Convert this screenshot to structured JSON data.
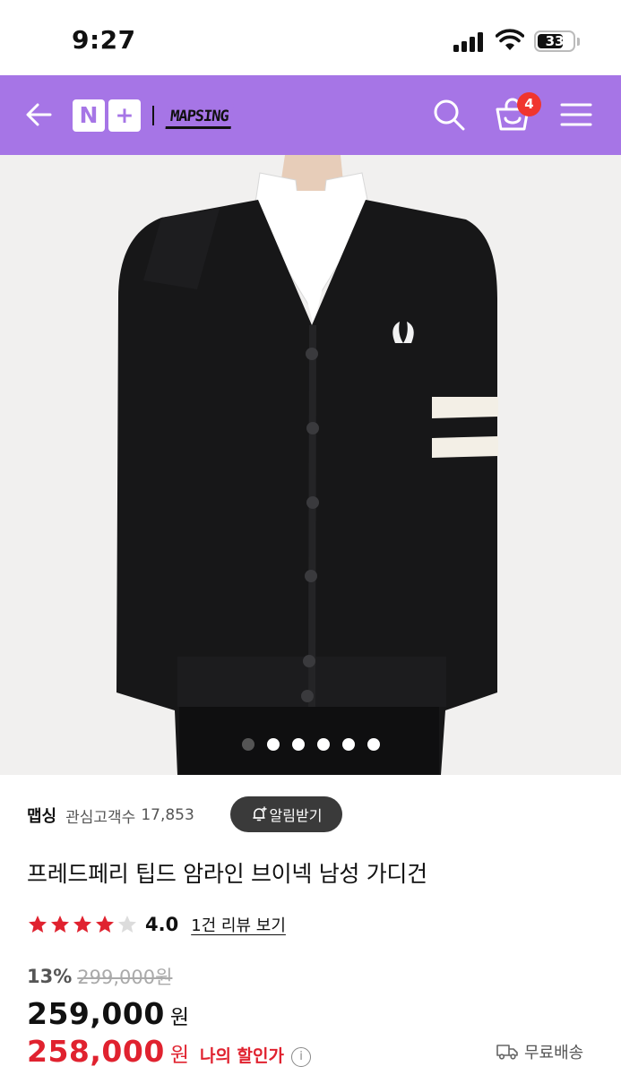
{
  "status_bar": {
    "time": "9:27",
    "battery": "33"
  },
  "header": {
    "nplus_left": "N",
    "nplus_right": "+",
    "brand": "MAPSING",
    "cart_count": "4"
  },
  "gallery": {
    "total_images": 6,
    "active_index": 0
  },
  "seller": {
    "name": "맵싱",
    "fav_label": "관심고객수",
    "fav_count": "17,853",
    "alarm_button": "알림받기"
  },
  "product": {
    "title": "프레드페리 팁드 암라인 브이넥 남성 가디건"
  },
  "rating": {
    "stars_filled": 4,
    "stars_total": 5,
    "score": "4.0",
    "review_link": "1건 리뷰 보기"
  },
  "pricing": {
    "discount_rate": "13%",
    "original_price": "299,000원",
    "price": "259,000",
    "price_unit": "원",
    "my_price": "258,000",
    "my_price_unit": "원",
    "my_price_label": "나의 할인가",
    "info_icon": "i"
  },
  "shipping": {
    "label": "무료배송"
  },
  "colors": {
    "header": "#a675e6",
    "badge": "#f0352e",
    "sale": "#e0222f",
    "star": "#e0222f"
  }
}
